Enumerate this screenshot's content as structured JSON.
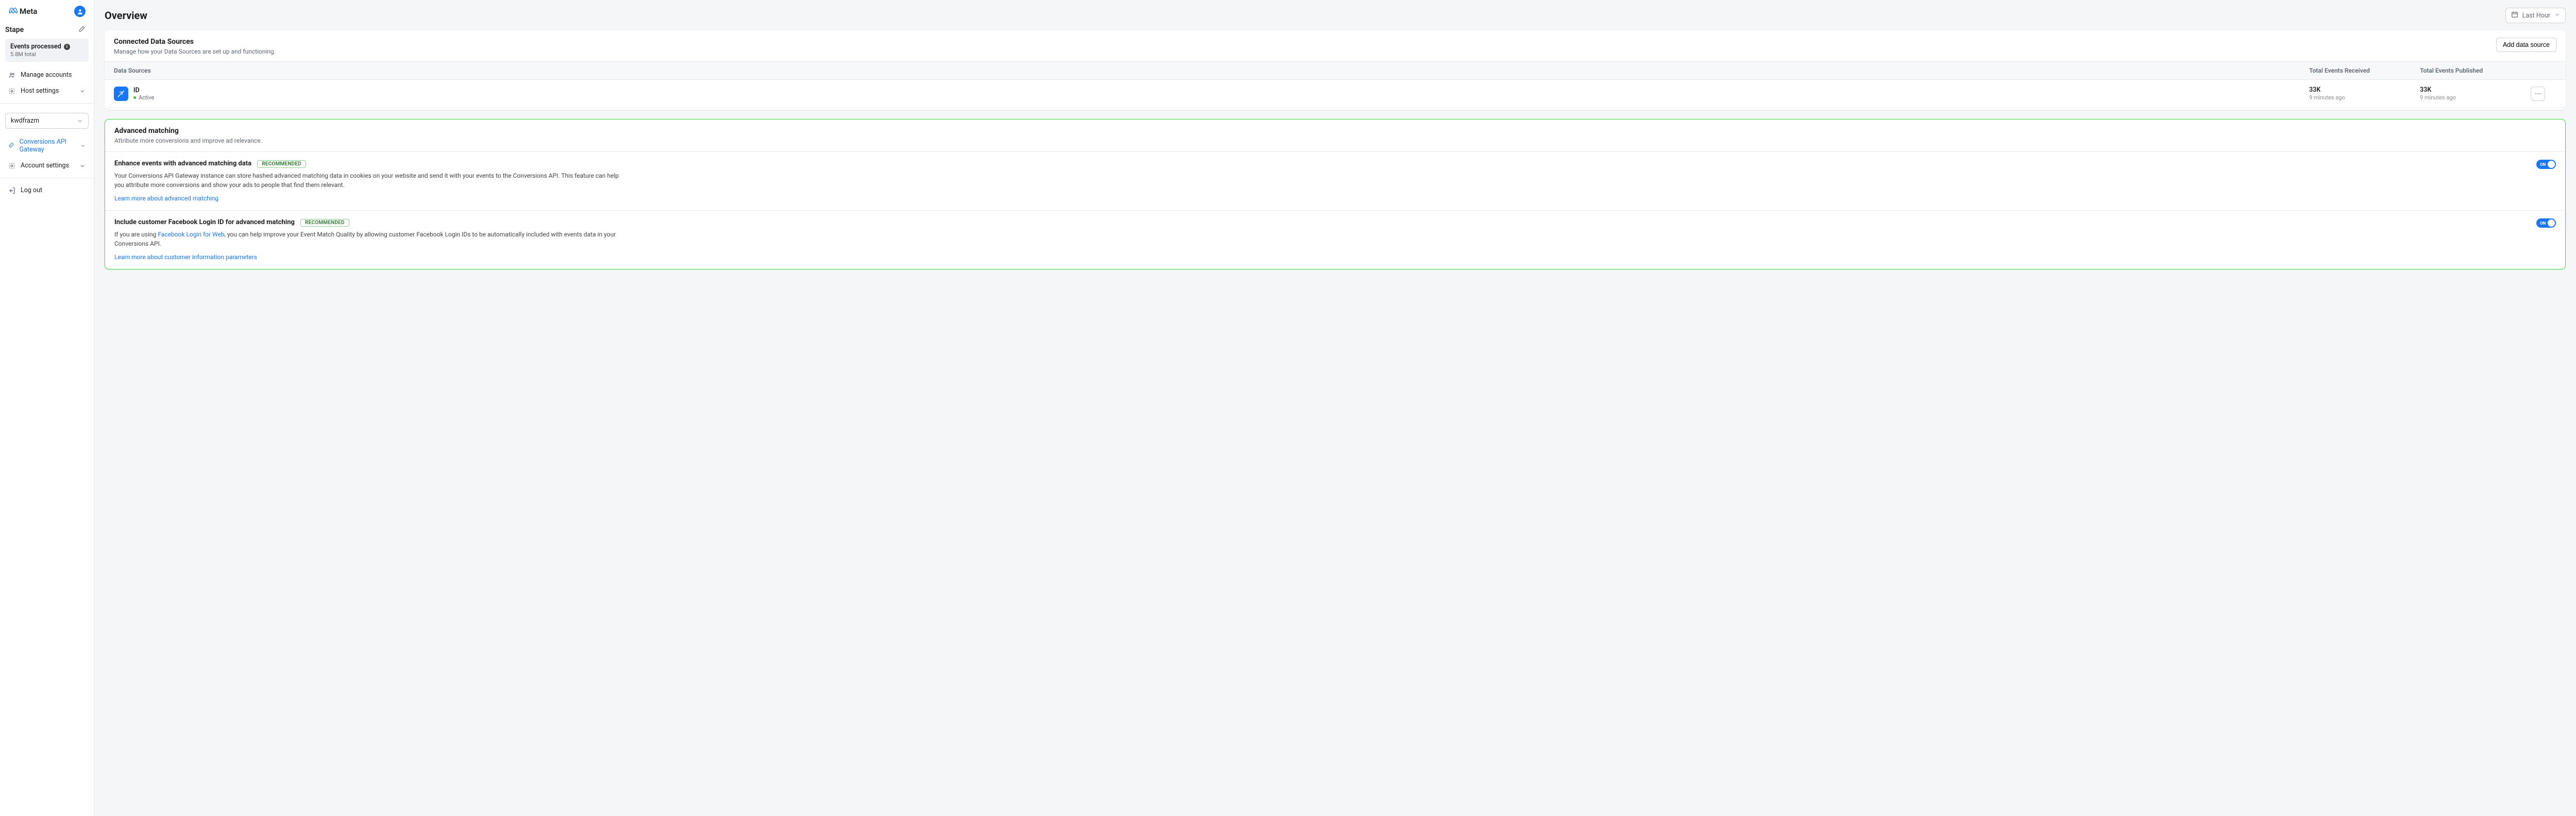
{
  "brand": "Meta",
  "user": {
    "avatar_initial": ""
  },
  "sidebar": {
    "workspace": "Stape",
    "events_card": {
      "title": "Events processed",
      "subtitle": "5.8M total"
    },
    "nav1": [
      {
        "label": "Manage accounts"
      },
      {
        "label": "Host settings"
      }
    ],
    "project": "kwdfrazm",
    "nav2": [
      {
        "label": "Conversions API Gateway"
      },
      {
        "label": "Account settings"
      }
    ],
    "logout": "Log out"
  },
  "header": {
    "title": "Overview",
    "time_label": "Last Hour"
  },
  "sources_card": {
    "title": "Connected Data Sources",
    "subtitle": "Manage how your Data Sources are set up and functioning.",
    "add_button": "Add data source",
    "columns": {
      "ds": "Data Sources",
      "ter": "Total Events Received",
      "tep": "Total Events Published"
    },
    "rows": [
      {
        "name": "ID",
        "status": "Active",
        "ter_value": "33K",
        "ter_sub": "9 minutes ago",
        "tep_value": "33K",
        "tep_sub": "9 minutes ago"
      }
    ]
  },
  "matching_card": {
    "title": "Advanced matching",
    "subtitle": "Attribute more conversions and improve ad relevance.",
    "enhance": {
      "title": "Enhance events with advanced matching data",
      "badge": "RECOMMENDED",
      "desc": "Your Conversions API Gateway instance can store hashed advanced matching data in cookies on your website and send it with your events to the Conversions API. This feature can help you attribute more conversions and show your ads to people that find them relevant.",
      "link": "Learn more about advanced matching",
      "toggle": "ON"
    },
    "login": {
      "title": "Include customer Facebook Login ID for advanced matching",
      "badge": "RECOMMENDED",
      "desc_pre": "If you are using ",
      "desc_link": "Facebook Login for Web",
      "desc_post": ", you can help improve your Event Match Quality by allowing customer Facebook Login IDs to be automatically included with events data in your Conversions API.",
      "link": "Learn more about customer information parameters",
      "toggle": "ON"
    }
  }
}
